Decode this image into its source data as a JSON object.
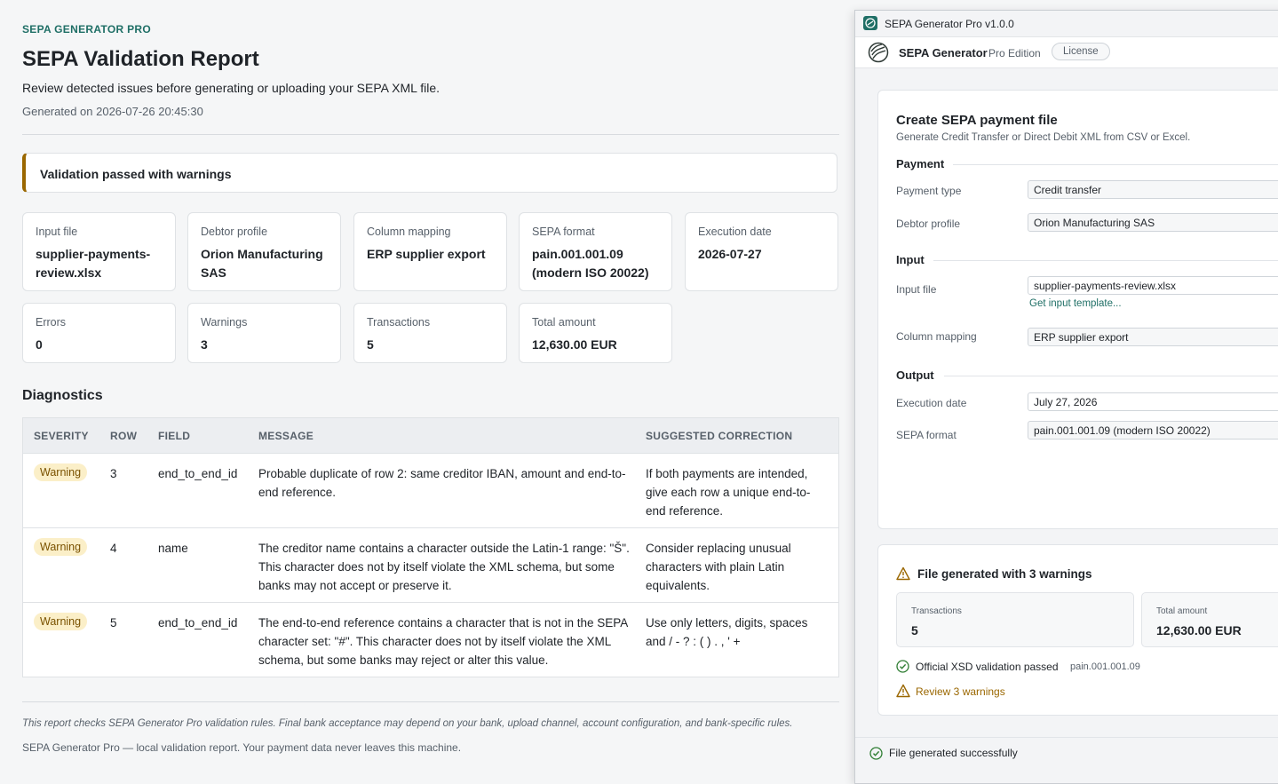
{
  "report": {
    "brand": "SEPA GENERATOR PRO",
    "title": "SEPA Validation Report",
    "subtitle": "Review detected issues before generating or uploading your SEPA XML file.",
    "generated": "Generated on 2026-07-26 20:45:30",
    "banner": "Validation passed with warnings",
    "cards": [
      {
        "label": "Input file",
        "value": "supplier-payments-review.xlsx"
      },
      {
        "label": "Debtor profile",
        "value": "Orion Manufacturing SAS"
      },
      {
        "label": "Column mapping",
        "value": "ERP supplier export"
      },
      {
        "label": "SEPA format",
        "value": "pain.001.001.09 (modern ISO 20022)"
      },
      {
        "label": "Execution date",
        "value": "2026-07-27"
      },
      {
        "label": "Errors",
        "value": "0"
      },
      {
        "label": "Warnings",
        "value": "3"
      },
      {
        "label": "Transactions",
        "value": "5"
      },
      {
        "label": "Total amount",
        "value": "12,630.00 EUR"
      }
    ],
    "diagnostics_title": "Diagnostics",
    "columns": [
      "SEVERITY",
      "ROW",
      "FIELD",
      "MESSAGE",
      "SUGGESTED CORRECTION"
    ],
    "rows": [
      {
        "severity": "Warning",
        "row": "3",
        "field": "end_to_end_id",
        "message": "Probable duplicate of row 2: same creditor IBAN, amount and end-to-end reference.",
        "correction": "If both payments are intended, give each row a unique end-to-end reference."
      },
      {
        "severity": "Warning",
        "row": "4",
        "field": "name",
        "message": "The creditor name contains a character outside the Latin-1 range: \"Š\". This character does not by itself violate the XML schema, but some banks may not accept or preserve it.",
        "correction": "Consider replacing unusual characters with plain Latin equivalents."
      },
      {
        "severity": "Warning",
        "row": "5",
        "field": "end_to_end_id",
        "message": "The end-to-end reference contains a character that is not in the SEPA character set: \"#\". This character does not by itself violate the XML schema, but some banks may reject or alter this value.",
        "correction": "Use only letters, digits, spaces and / - ? : ( ) . , ' +"
      }
    ],
    "disclaimer": "This report checks SEPA Generator Pro validation rules. Final bank acceptance may depend on your bank, upload channel, account configuration, and bank-specific rules.",
    "footnote": "SEPA Generator Pro — local validation report. Your payment data never leaves this machine."
  },
  "app": {
    "window_title": "SEPA Generator Pro v1.0.0",
    "name": "SEPA Generator",
    "edition": "Pro Edition",
    "license_button": "License",
    "form": {
      "title": "Create SEPA payment file",
      "subtitle": "Generate Credit Transfer or Direct Debit XML from CSV or Excel.",
      "payment_section": "Payment",
      "payment_type_label": "Payment type",
      "payment_type_value": "Credit transfer",
      "debtor_profile_label": "Debtor profile",
      "debtor_profile_value": "Orion Manufacturing SAS",
      "input_section": "Input",
      "input_file_label": "Input file",
      "input_file_value": "supplier-payments-review.xlsx",
      "template_link": "Get input template...",
      "column_mapping_label": "Column mapping",
      "column_mapping_value": "ERP supplier export",
      "output_section": "Output",
      "execution_date_label": "Execution date",
      "execution_date_value": "July 27, 2026",
      "sepa_format_label": "SEPA format",
      "sepa_format_value": "pain.001.001.09 (modern ISO 20022)"
    },
    "result": {
      "title": "File generated with 3 warnings",
      "transactions_label": "Transactions",
      "transactions_value": "5",
      "total_label": "Total amount",
      "total_value": "12,630.00 EUR",
      "xsd_text": "Official XSD validation passed",
      "xsd_format": "pain.001.001.09",
      "review_link": "Review 3 warnings"
    },
    "status": "File generated successfully"
  },
  "colors": {
    "accent": "#1f6f66",
    "warning": "#9a6700",
    "success": "#2e7d32"
  }
}
